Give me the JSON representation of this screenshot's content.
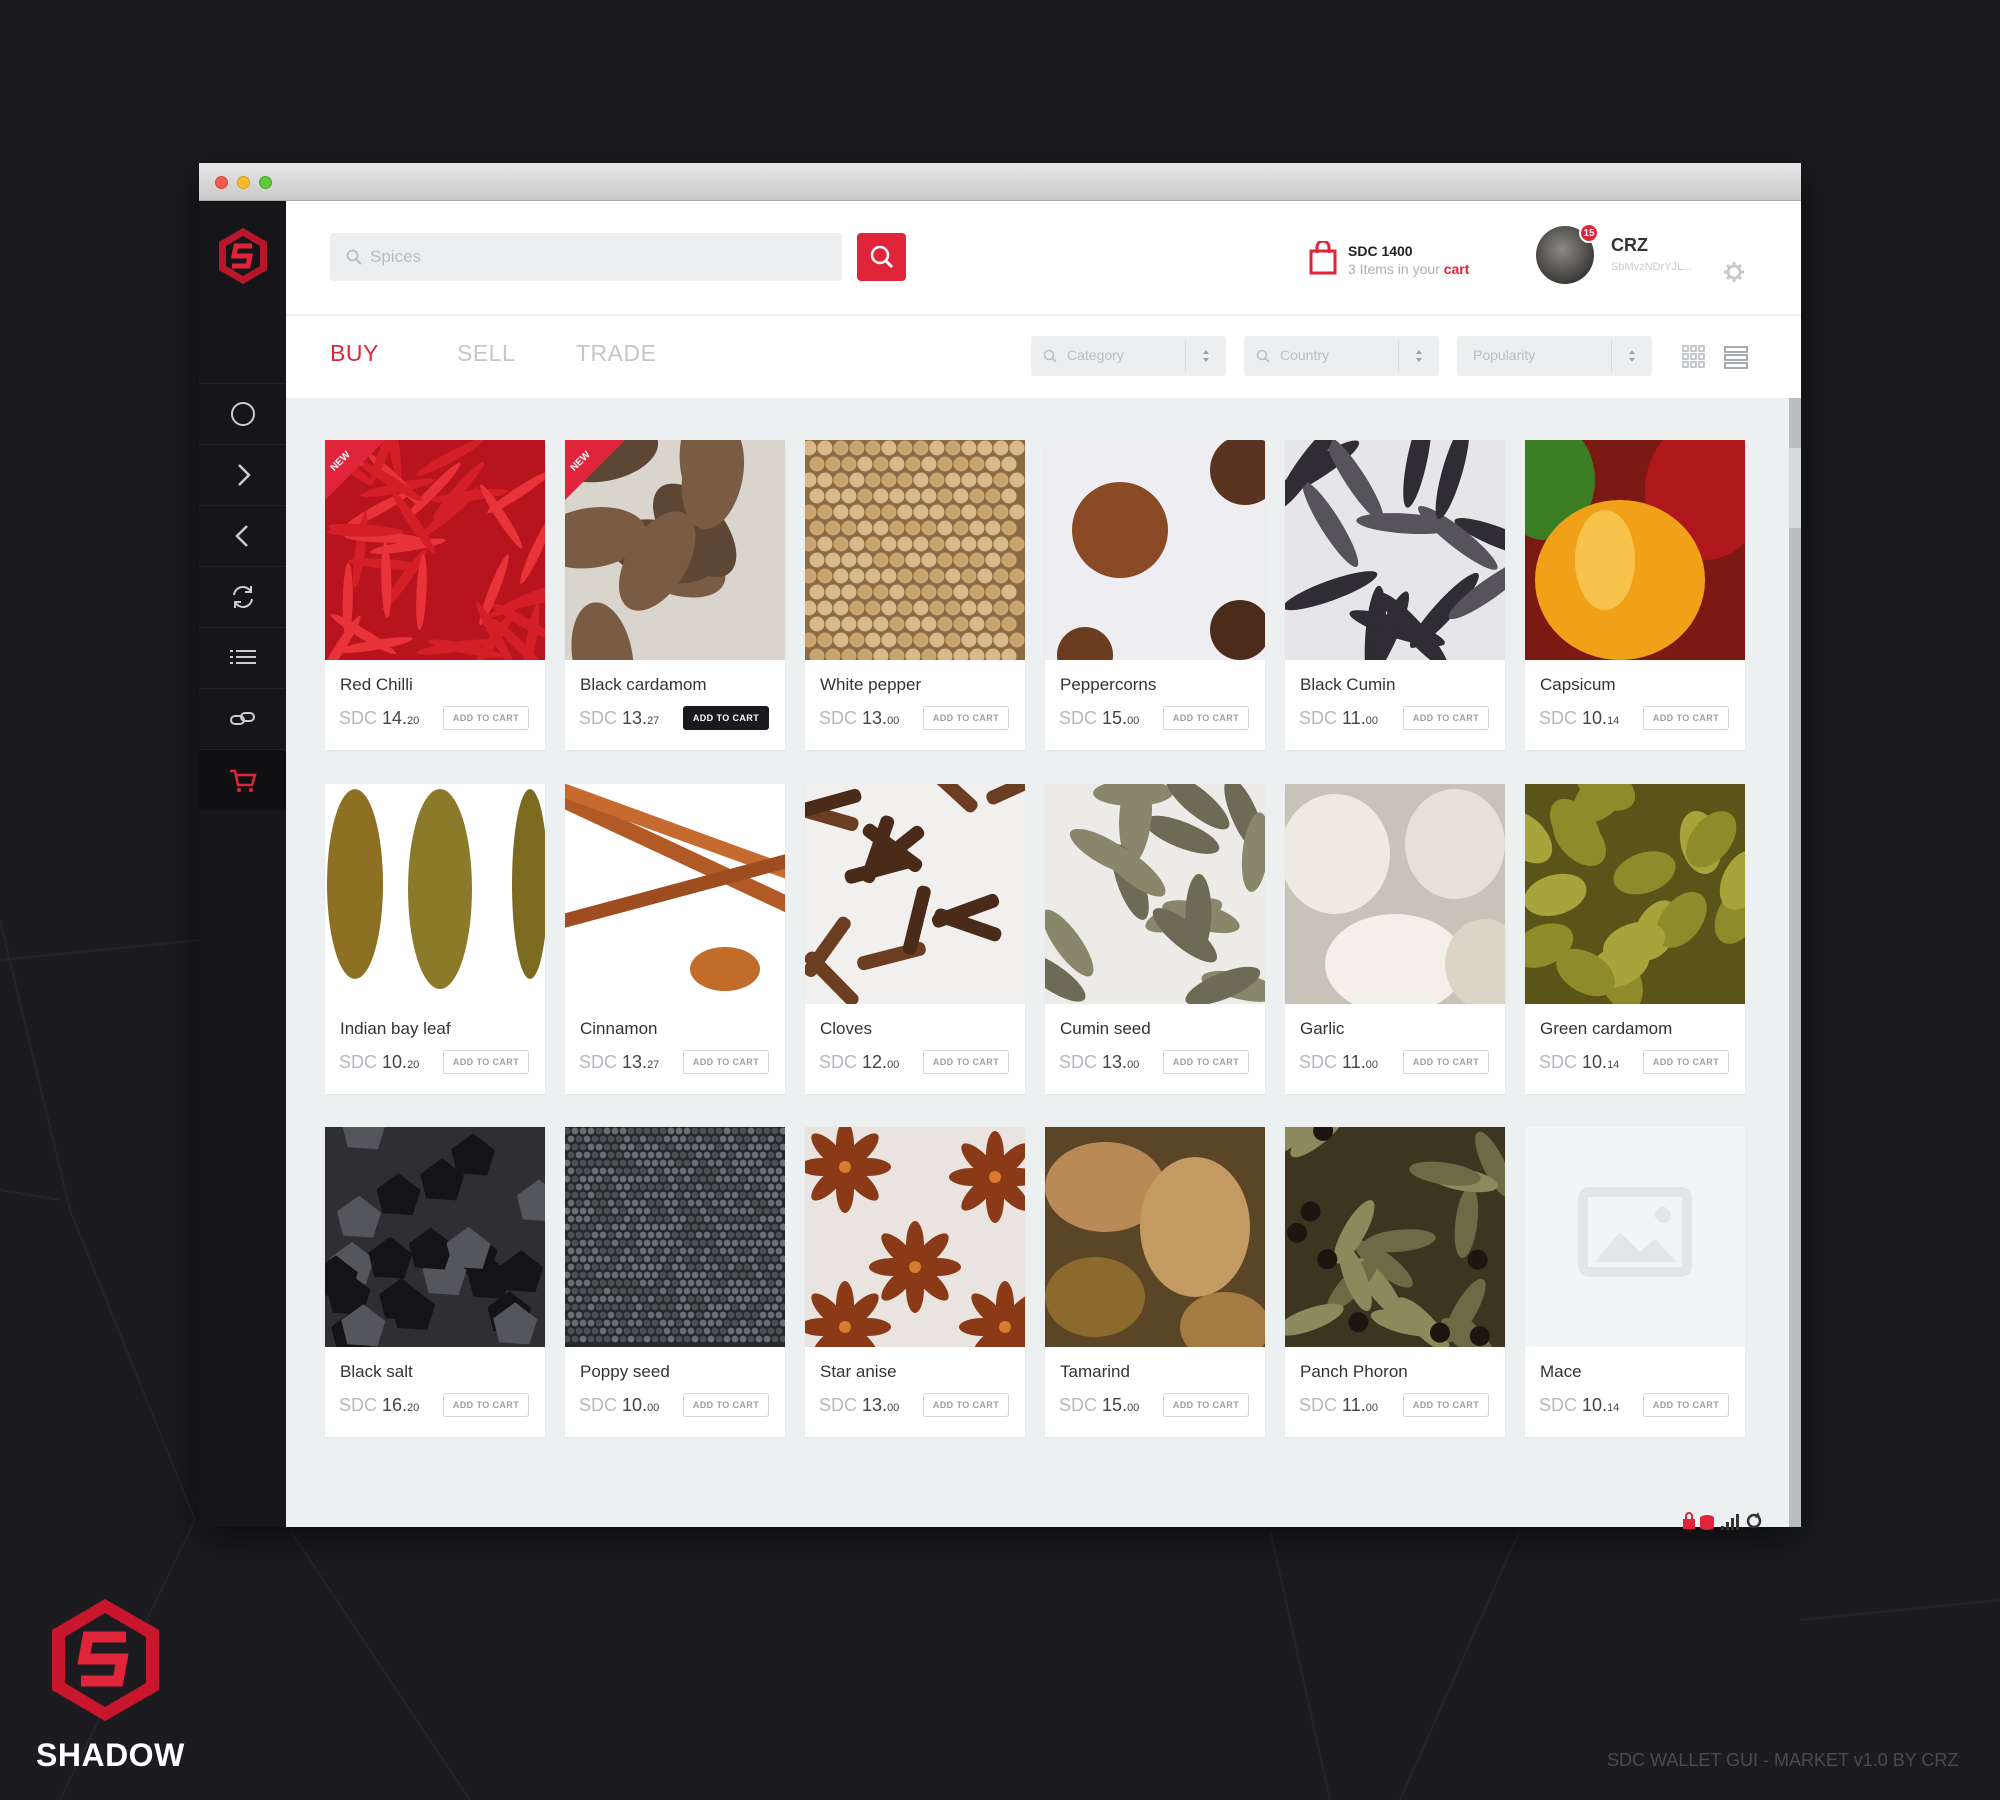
{
  "window": {
    "controls": [
      "close",
      "minimize",
      "maximize"
    ]
  },
  "sidebar": {
    "logo": "shadow-logo",
    "items": [
      {
        "icon": "circle-icon"
      },
      {
        "icon": "chevron-right-icon"
      },
      {
        "icon": "chevron-left-icon"
      },
      {
        "icon": "refresh-icon"
      },
      {
        "icon": "list-icon"
      },
      {
        "icon": "chain-link-icon"
      },
      {
        "icon": "cart-icon",
        "active": true
      }
    ]
  },
  "search": {
    "placeholder": "Spices",
    "value": ""
  },
  "cart": {
    "amount": "SDC 1400",
    "items_prefix": "3 Items in your ",
    "items_link": "cart"
  },
  "user": {
    "name": "CRZ",
    "address": "SbMvzNDrYJL...",
    "notifications": "15"
  },
  "tabs": [
    {
      "label": "BUY",
      "active": true
    },
    {
      "label": "SELL",
      "active": false
    },
    {
      "label": "TRADE",
      "active": false
    }
  ],
  "filters": [
    {
      "label": "Category"
    },
    {
      "label": "Country"
    },
    {
      "label": "Popularity"
    }
  ],
  "add_to_cart_label": "ADD TO CART",
  "new_badge": "NEW",
  "products": [
    {
      "name": "Red Chilli",
      "currency": "SDC",
      "int": "14.",
      "dec": "20",
      "badge": true,
      "selected": false,
      "image": "red-chilli"
    },
    {
      "name": "Black cardamom",
      "currency": "SDC",
      "int": "13.",
      "dec": "27",
      "badge": true,
      "selected": true,
      "image": "black-cardamom"
    },
    {
      "name": "White pepper",
      "currency": "SDC",
      "int": "13.",
      "dec": "00",
      "badge": false,
      "selected": false,
      "image": "white-pepper"
    },
    {
      "name": "Peppercorns",
      "currency": "SDC",
      "int": "15.",
      "dec": "00",
      "badge": false,
      "selected": false,
      "image": "peppercorns"
    },
    {
      "name": "Black Cumin",
      "currency": "SDC",
      "int": "11.",
      "dec": "00",
      "badge": false,
      "selected": false,
      "image": "black-cumin"
    },
    {
      "name": "Capsicum",
      "currency": "SDC",
      "int": "10.",
      "dec": "14",
      "badge": false,
      "selected": false,
      "image": "capsicum"
    },
    {
      "name": "Indian bay leaf",
      "currency": "SDC",
      "int": "10.",
      "dec": "20",
      "badge": false,
      "selected": false,
      "image": "bay-leaf"
    },
    {
      "name": "Cinnamon",
      "currency": "SDC",
      "int": "13.",
      "dec": "27",
      "badge": false,
      "selected": false,
      "image": "cinnamon"
    },
    {
      "name": "Cloves",
      "currency": "SDC",
      "int": "12.",
      "dec": "00",
      "badge": false,
      "selected": false,
      "image": "cloves"
    },
    {
      "name": "Cumin seed",
      "currency": "SDC",
      "int": "13.",
      "dec": "00",
      "badge": false,
      "selected": false,
      "image": "cumin-seed"
    },
    {
      "name": "Garlic",
      "currency": "SDC",
      "int": "11.",
      "dec": "00",
      "badge": false,
      "selected": false,
      "image": "garlic"
    },
    {
      "name": "Green cardamom",
      "currency": "SDC",
      "int": "10.",
      "dec": "14",
      "badge": false,
      "selected": false,
      "image": "green-cardamom"
    },
    {
      "name": "Black salt",
      "currency": "SDC",
      "int": "16.",
      "dec": "20",
      "badge": false,
      "selected": false,
      "image": "black-salt"
    },
    {
      "name": "Poppy seed",
      "currency": "SDC",
      "int": "10.",
      "dec": "00",
      "badge": false,
      "selected": false,
      "image": "poppy-seed"
    },
    {
      "name": "Star anise",
      "currency": "SDC",
      "int": "13.",
      "dec": "00",
      "badge": false,
      "selected": false,
      "image": "star-anise"
    },
    {
      "name": "Tamarind",
      "currency": "SDC",
      "int": "15.",
      "dec": "00",
      "badge": false,
      "selected": false,
      "image": "tamarind"
    },
    {
      "name": "Panch Phoron",
      "currency": "SDC",
      "int": "11.",
      "dec": "00",
      "badge": false,
      "selected": false,
      "image": "panch-phoron"
    },
    {
      "name": "Mace",
      "currency": "SDC",
      "int": "10.",
      "dec": "14",
      "badge": false,
      "selected": false,
      "image": "placeholder"
    }
  ],
  "status_icons": [
    "lock-icon",
    "database-icon",
    "signal-icon",
    "sync-icon"
  ],
  "brand": {
    "name": "SHADOW"
  },
  "footer": {
    "text": "SDC WALLET GUI - MARKET  v1.0 BY CRZ"
  },
  "colors": {
    "accent": "#e0253a",
    "sidebar": "#16161a",
    "background": "#1b1b20",
    "content": "#edf0f1"
  }
}
